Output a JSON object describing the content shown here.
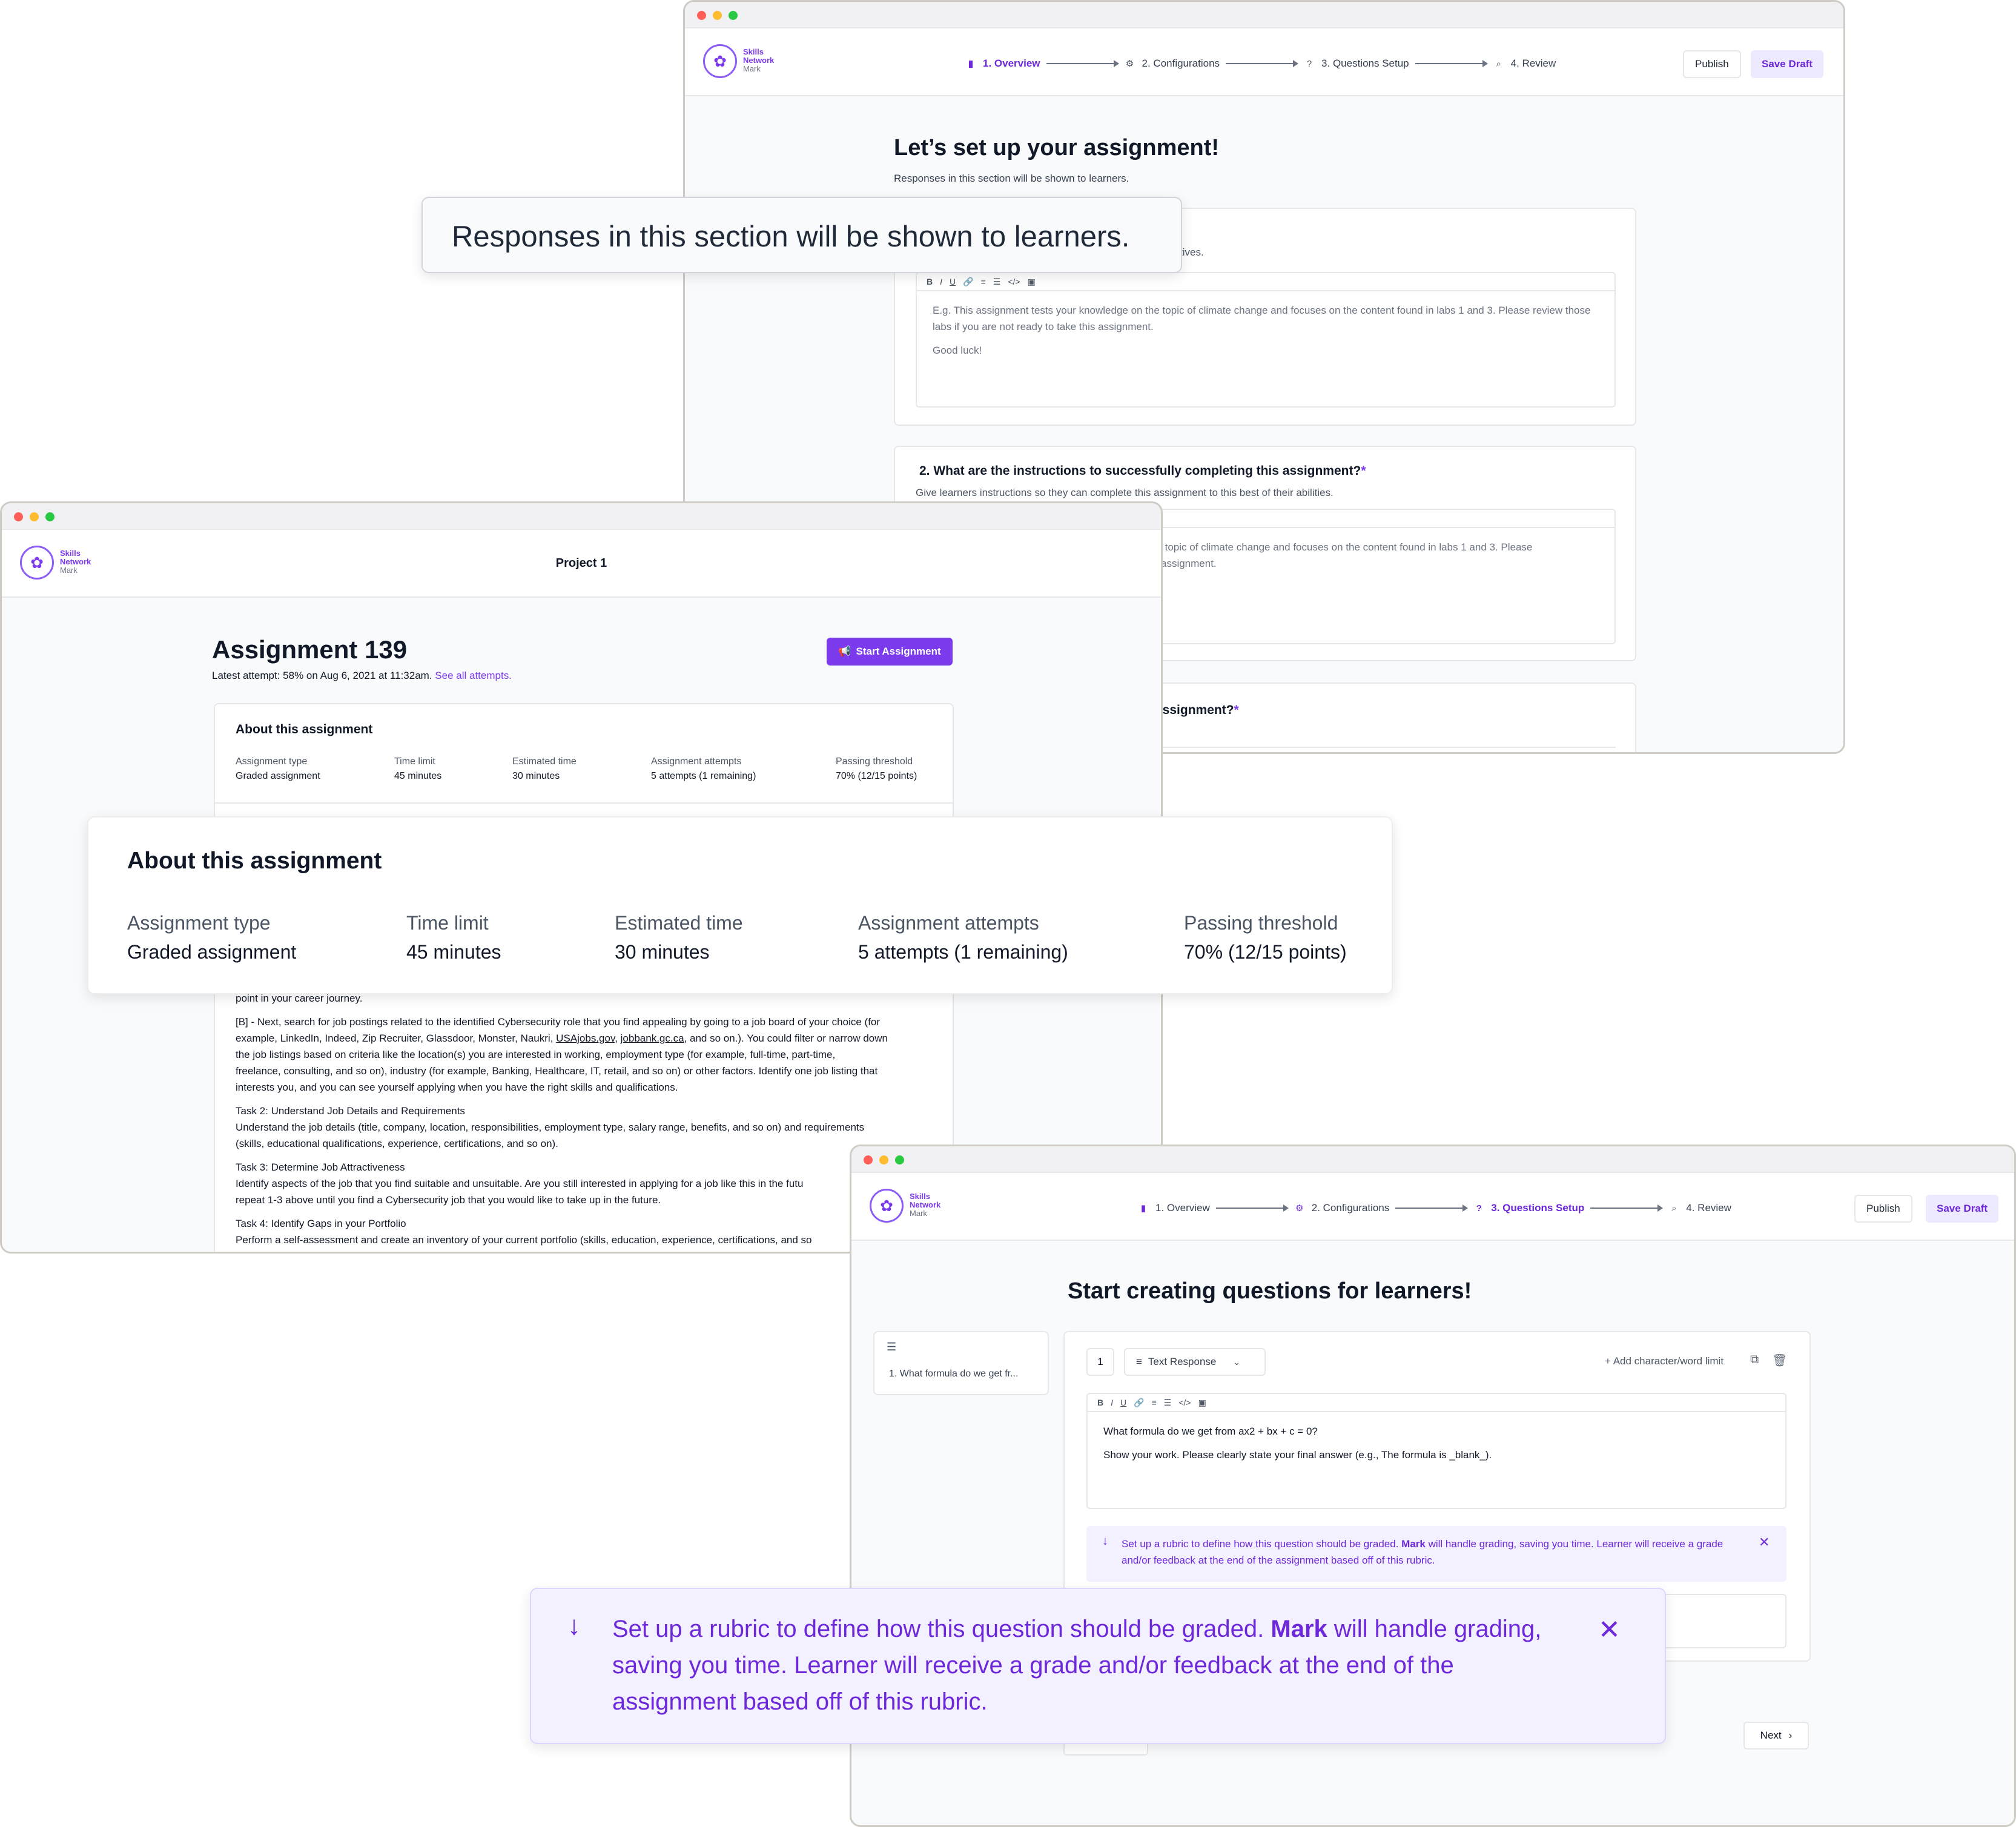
{
  "brand": {
    "line1": "Skills",
    "line2": "Network",
    "line3": "Mark"
  },
  "stepper": {
    "step1": "1. Overview",
    "step2": "2. Configurations",
    "step3": "3. Questions Setup",
    "step4": "4. Review"
  },
  "toolbar": {
    "publish": "Publish",
    "save_draft": "Save Draft"
  },
  "setup_window": {
    "heading": "Let’s set up your assignment!",
    "subheading": "Responses in this section will be shown to learners.",
    "q1_desc_tail": "tives.",
    "q1_placeholder_1": "E.g. This assignment tests your knowledge on the topic of climate change and focuses on the content found in labs 1 and 3. Please review those labs if you are not ready to take this assignment.",
    "q1_placeholder_2": "Good luck!",
    "q2_title": "2. What are the instructions to successfully completing this assignment?",
    "q2_required": "*",
    "q2_desc": "Give learners instructions so they can complete this assignment to this best of their abilities.",
    "q2_placeholder_tail_1": "he topic of climate change and focuses on the content found in labs 1 and 3. Please",
    "q2_placeholder_tail_2": "is assignment.",
    "q3_title_tail": "assignment?",
    "q3_required": "*"
  },
  "callout_responses": {
    "text": "Responses in this section will be shown to learners."
  },
  "learner_window": {
    "project_title": "Project 1",
    "assignment_title": "Assignment 139",
    "latest_attempt": "Latest attempt: 58% on Aug 6, 2021 at 11:32am.",
    "see_all_attempts": "See all attempts.",
    "start_button": "Start Assignment",
    "about_heading": "About this assignment",
    "meta": [
      {
        "label": "Assignment type",
        "value": "Graded assignment"
      },
      {
        "label": "Time limit",
        "value": "45 minutes"
      },
      {
        "label": "Estimated time",
        "value": "30 minutes"
      },
      {
        "label": "Assignment attempts",
        "value": "5 attempts (1 remaining)"
      },
      {
        "label": "Passing threshold",
        "value": "70% (12/15 points)"
      }
    ],
    "body": {
      "career_tail": "point in your career journey.",
      "b_para_1": "[B] - Next, search for job postings related to the identified Cybersecurity role that you find appealing by going to a job board of your choice (for",
      "b_para_2_pre": "example, LinkedIn, Indeed, Zip Recruiter, Glassdoor, Monster, Naukri,",
      "b_para_2_link1": "USAjobs.gov",
      "b_para_2_link2": "jobbank.gc.ca",
      "b_para_2_post": ", and so on.). You could filter or narrow down",
      "b_para_3": "the job listings based on criteria like the location(s) you are interested in working, employment type (for example, full-time, part-time,",
      "b_para_4": "freelance, consulting, and so on), industry (for example, Banking, Healthcare, IT, retail, and so on) or other factors. Identify one job listing that",
      "b_para_5": "interests you, and you can see yourself applying when you have the right skills and qualifications.",
      "task2_title": "Task 2: Understand Job Details and Requirements",
      "task2_1": "Understand the job details (title, company, location, responsibilities, employment type, salary range, benefits, and so on) and requirements",
      "task2_2": "(skills, educational qualifications, experience, certifications, and so on).",
      "task3_title": "Task 3: Determine Job Attractiveness",
      "task3_1": "Identify aspects of the job that you find suitable and unsuitable. Are you still interested in applying for a job like this in the futu",
      "task3_2": "repeat 1-3 above until you find a Cybersecurity job that you would like to take up in the future.",
      "task4_title": "Task 4: Identify Gaps in your Portfolio",
      "task4_1": "Perform a self-assessment and create an inventory of your current portfolio (skills, education, experience, certifications, and so"
    }
  },
  "callout_about": {
    "heading": "About this assignment",
    "meta": [
      {
        "label": "Assignment type",
        "value": "Graded assignment"
      },
      {
        "label": "Time limit",
        "value": "45 minutes"
      },
      {
        "label": "Estimated time",
        "value": "30 minutes"
      },
      {
        "label": "Assignment attempts",
        "value": "5 attempts (1 remaining)"
      },
      {
        "label": "Passing threshold",
        "value": "70% (12/15 points)"
      }
    ]
  },
  "questions_window": {
    "heading": "Start creating questions for learners!",
    "sidebar_item": "1. What formula do we get fr...",
    "question_number": "1",
    "question_type": "Text Response",
    "add_limit": "+ Add character/word limit",
    "question_text": "What formula do we get from ax2 + bx + c = 0?",
    "question_instructions": "Show your work. Please clearly state your final answer (e.g., The formula is _blank_).",
    "rubric_pre": "Set up a rubric to define how this question should be graded.",
    "rubric_brand": "Mark",
    "rubric_post": "will handle grading, saving you time. Learner will receive a grade and/or feedback at the end of the assignment based off of this rubric.",
    "next_button": "Next"
  },
  "callout_rubric": {
    "pre": "Set up a rubric to define how this question should be graded.",
    "brand": "Mark",
    "post": "will handle grading, saving you time. Learner will receive a grade and/or feedback at the end of the assignment based off of this rubric."
  },
  "icons": {
    "overview": "document-icon",
    "configurations": "gear-icon",
    "questions": "question-circle-icon",
    "review": "search-icon",
    "start": "megaphone-icon",
    "close": "close-icon",
    "arrow_down": "arrow-down-icon"
  },
  "colors": {
    "accent": "#7c3aed",
    "accent_soft": "#ede9fe",
    "callout_purple_bg": "#f3f0ff"
  }
}
